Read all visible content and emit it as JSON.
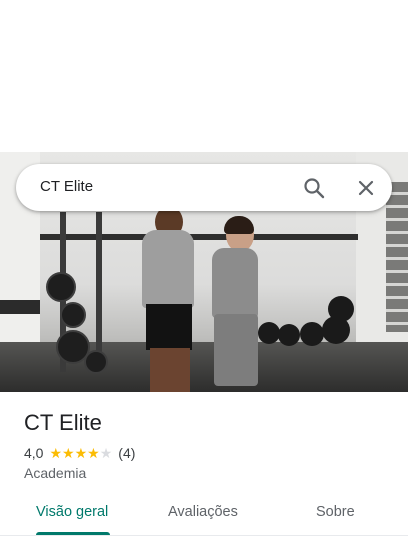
{
  "search": {
    "value": "CT Elite",
    "search_icon": "search-icon",
    "close_icon": "close-icon"
  },
  "place": {
    "name": "CT Elite",
    "rating": "4,0",
    "stars": 4,
    "stars_max": 5,
    "review_count": "(4)",
    "category": "Academia"
  },
  "tabs": [
    {
      "label": "Visão geral",
      "active": true
    },
    {
      "label": "Avaliações",
      "active": false
    },
    {
      "label": "Sobre",
      "active": false
    }
  ],
  "colors": {
    "accent": "#00796b",
    "star": "#fbbc04",
    "star_empty": "#dadce0"
  }
}
